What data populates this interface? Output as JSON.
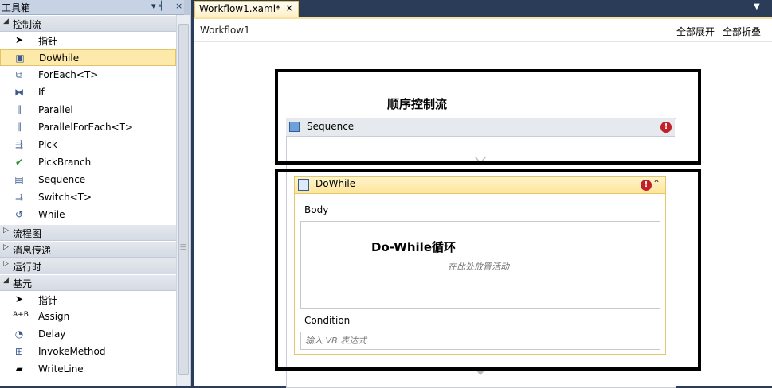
{
  "toolbox": {
    "title": "工具箱",
    "pin_glyph": "▾ ╡",
    "close_glyph": "×",
    "categories": [
      {
        "label": "控制流",
        "expanded": true,
        "items": [
          {
            "label": "指针",
            "icon": "pointer-icon"
          },
          {
            "label": "DoWhile",
            "icon": "dowhile-icon",
            "selected": true
          },
          {
            "label": "ForEach<T>",
            "icon": "foreach-icon"
          },
          {
            "label": "If",
            "icon": "if-icon"
          },
          {
            "label": "Parallel",
            "icon": "parallel-icon"
          },
          {
            "label": "ParallelForEach<T>",
            "icon": "parallel-foreach-icon"
          },
          {
            "label": "Pick",
            "icon": "pick-icon"
          },
          {
            "label": "PickBranch",
            "icon": "pickbranch-icon"
          },
          {
            "label": "Sequence",
            "icon": "sequence-icon"
          },
          {
            "label": "Switch<T>",
            "icon": "switch-icon"
          },
          {
            "label": "While",
            "icon": "while-icon"
          }
        ]
      },
      {
        "label": "流程图",
        "expanded": false
      },
      {
        "label": "消息传递",
        "expanded": false
      },
      {
        "label": "运行时",
        "expanded": false
      },
      {
        "label": "基元",
        "expanded": true,
        "items": [
          {
            "label": "指针",
            "icon": "pointer-icon"
          },
          {
            "label": "Assign",
            "icon": "assign-icon",
            "glyph": "A+B"
          },
          {
            "label": "Delay",
            "icon": "clock-icon"
          },
          {
            "label": "InvokeMethod",
            "icon": "invoke-method-icon"
          },
          {
            "label": "WriteLine",
            "icon": "writeline-icon"
          }
        ]
      }
    ]
  },
  "document": {
    "tab_label": "Workflow1.xaml*",
    "tab_close": "×",
    "breadcrumb": "Workflow1",
    "expand_all": "全部展开",
    "collapse_all": "全部折叠"
  },
  "sequence": {
    "title": "Sequence",
    "error_glyph": "!"
  },
  "dowhile": {
    "title": "DoWhile",
    "error_glyph": "!",
    "collapse_glyph": "⌃",
    "body_label": "Body",
    "drop_hint": "在此处放置活动",
    "condition_label": "Condition",
    "condition_placeholder": "输入 VB 表达式"
  },
  "annotations": {
    "box1_text": "顺序控制流",
    "box2_text": "Do-While循环"
  },
  "colors": {
    "chrome": "#2b3c59",
    "selection": "#fde9a9",
    "activity_header": "#fde59a",
    "error": "#c0202a"
  }
}
